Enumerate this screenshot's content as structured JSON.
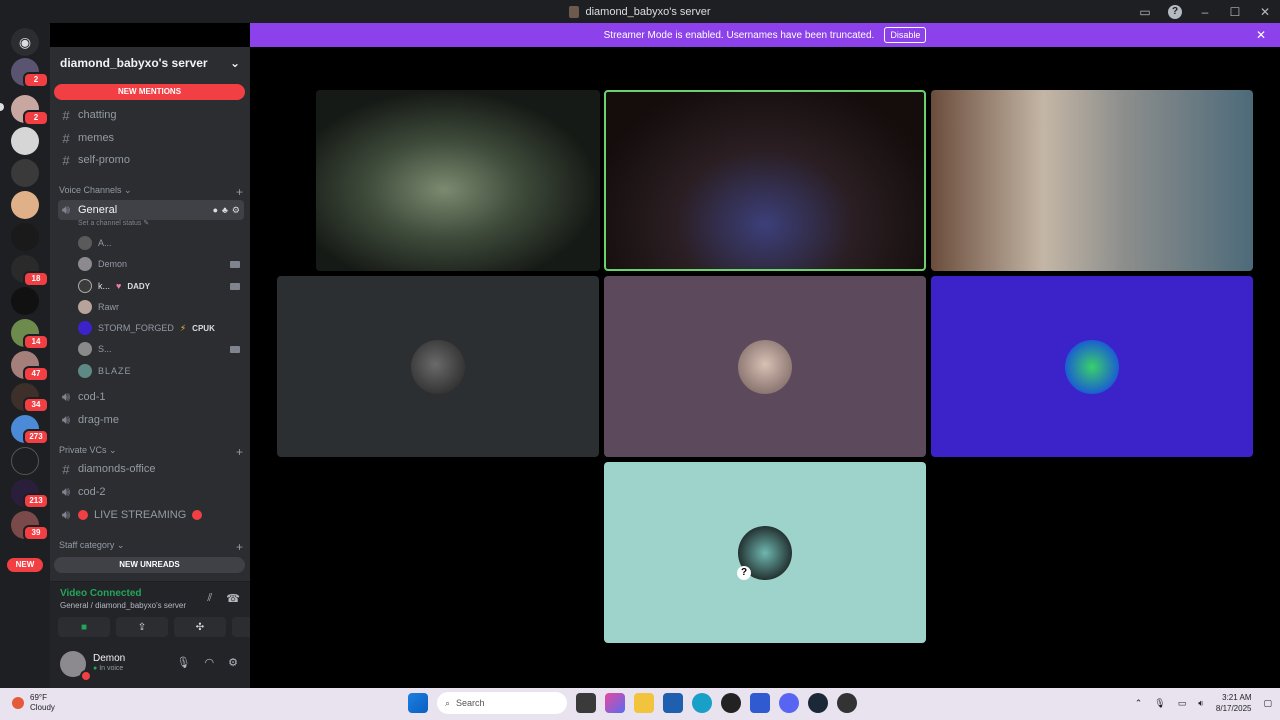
{
  "window": {
    "title": "diamond_babyxo's server"
  },
  "banner": {
    "text": "Streamer Mode is enabled. Usernames have been truncated.",
    "disable_label": "Disable"
  },
  "rail": {
    "badges": [
      "2",
      "2",
      "18",
      "14",
      "47",
      "34",
      "273",
      "213",
      "39"
    ],
    "new_label": "NEW"
  },
  "server": {
    "name": "diamond_babyxo's server"
  },
  "sidebar": {
    "new_mentions": "NEW MENTIONS",
    "new_unreads": "NEW UNREADS",
    "text_channels": [
      "chatting",
      "memes",
      "self-promo"
    ],
    "voice_category": "Voice Channels",
    "active_voice": {
      "name": "General",
      "status": "Set a channel status"
    },
    "members": [
      {
        "name": "A..."
      },
      {
        "name": "Demon"
      },
      {
        "name": "k...",
        "tag": "DADY"
      },
      {
        "name": "Rawr"
      },
      {
        "name": "STORM_FORGED",
        "tag": "CPUK"
      },
      {
        "name": "S..."
      },
      {
        "name": "BLAZE"
      }
    ],
    "other_voice": [
      "cod-1",
      "drag-me"
    ],
    "private_category": "Private VCs",
    "private_channels": [
      "diamonds-office",
      "cod-2",
      "LIVE STREAMING"
    ],
    "staff_category": "Staff category"
  },
  "voice_panel": {
    "status": "Video Connected",
    "location": "General / diamond_babyxo's server"
  },
  "user": {
    "name": "Demon",
    "status": "In voice"
  },
  "taskbar": {
    "weather_temp": "69°F",
    "weather_desc": "Cloudy",
    "search_placeholder": "Search",
    "time": "3:21 AM",
    "date": "8/17/2025"
  },
  "colors": {
    "accent_purple": "#8c41eb",
    "mention_red": "#f23f43",
    "connected_green": "#23a55a",
    "speaking_border": "#6bd26b",
    "tile_dark": "#2b2f31",
    "tile_mauve": "#5c4a5c",
    "tile_blue": "#3b23c9",
    "tile_teal": "#9ed3cc"
  }
}
